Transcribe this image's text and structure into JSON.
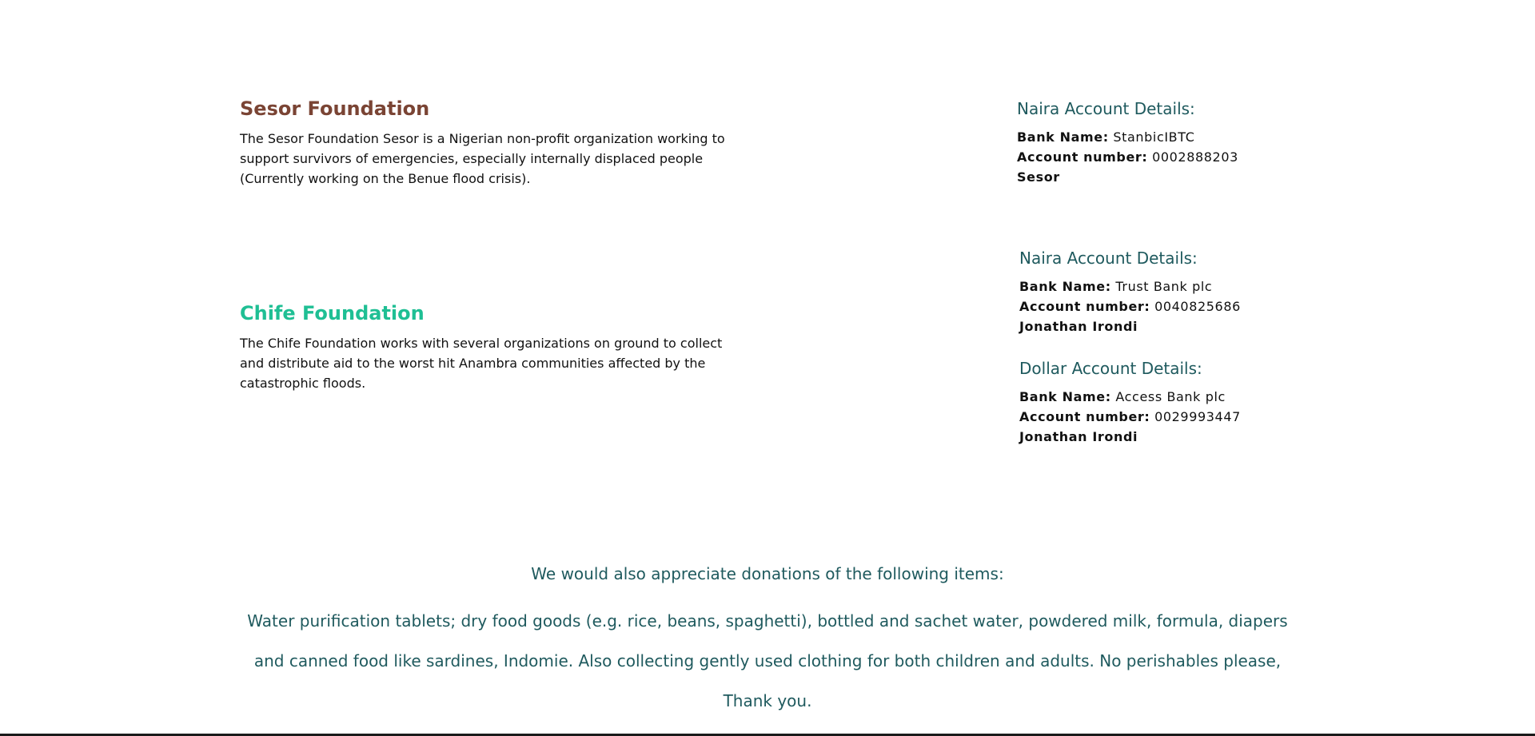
{
  "sesor": {
    "title": "Sesor Foundation",
    "title_color": "#7a4434",
    "description": "The Sesor Foundation Sesor is a Nigerian non-profit organization working to support survivors of emergencies, especially internally displaced people (Currently working on the Benue flood crisis).",
    "naira": {
      "heading": "Naira Account Details:",
      "bank_label": "Bank Name:",
      "bank_value": "StanbicIBTC",
      "account_label": "Account number:",
      "account_value": "0002888203",
      "holder": "Sesor"
    }
  },
  "chife": {
    "title": "Chife Foundation",
    "title_color": "#1fbf94",
    "description": "The Chife Foundation works with several organizations on ground to collect and distribute aid to the worst hit Anambra communities affected by the catastrophic floods.",
    "naira": {
      "heading": "Naira Account Details:",
      "bank_label": "Bank Name:",
      "bank_value": "Trust Bank plc",
      "account_label": "Account number:",
      "account_value": "0040825686",
      "holder": "Jonathan Irondi"
    },
    "dollar": {
      "heading": "Dollar Account Details:",
      "bank_label": "Bank Name:",
      "bank_value": "Access Bank plc",
      "account_label": "Account number:",
      "account_value": "0029993447",
      "holder": "Jonathan Irondi"
    }
  },
  "items": {
    "heading": "We would also appreciate donations of the following items:",
    "text": "Water purification tablets; dry food goods (e.g. rice, beans, spaghetti), bottled and sachet water, powdered milk, formula, diapers and canned food like sardines, Indomie. Also collecting gently used clothing for both children and adults. No perishables please, Thank you."
  }
}
